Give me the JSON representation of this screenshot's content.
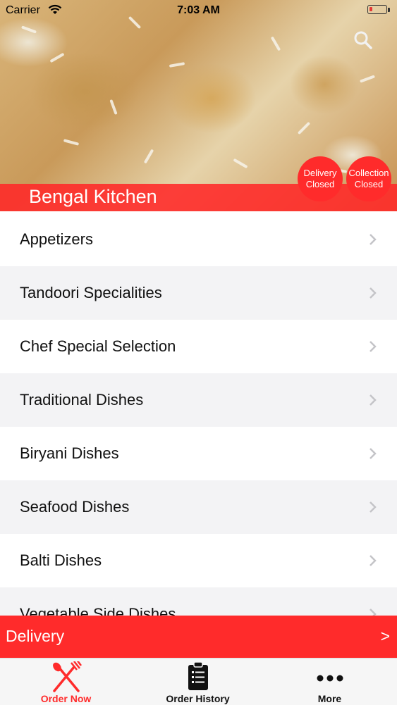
{
  "status_bar": {
    "carrier": "Carrier",
    "time": "7:03 AM"
  },
  "header": {
    "restaurant_name": "Bengal Kitchen",
    "delivery_status": {
      "line1": "Delivery",
      "line2": "Closed"
    },
    "collection_status": {
      "line1": "Collection",
      "line2": "Closed"
    },
    "search_icon": "search-icon"
  },
  "menu": {
    "categories": [
      "Appetizers",
      "Tandoori Specialities",
      "Chef Special Selection",
      "Traditional Dishes",
      "Biryani Dishes",
      "Seafood Dishes",
      "Balti Dishes",
      "Vegetable Side Dishes"
    ]
  },
  "order_bar": {
    "label": "Delivery",
    "arrow": ">"
  },
  "tabbar": {
    "tabs": [
      {
        "label": "Order Now",
        "icon": "fork-knife-icon",
        "active": true
      },
      {
        "label": "Order History",
        "icon": "clipboard-list-icon",
        "active": false
      },
      {
        "label": "More",
        "icon": "more-dots-icon",
        "active": false
      }
    ]
  },
  "colors": {
    "accent": "#ff2b2b",
    "row_alt": "#f3f3f5",
    "text": "#111111"
  }
}
